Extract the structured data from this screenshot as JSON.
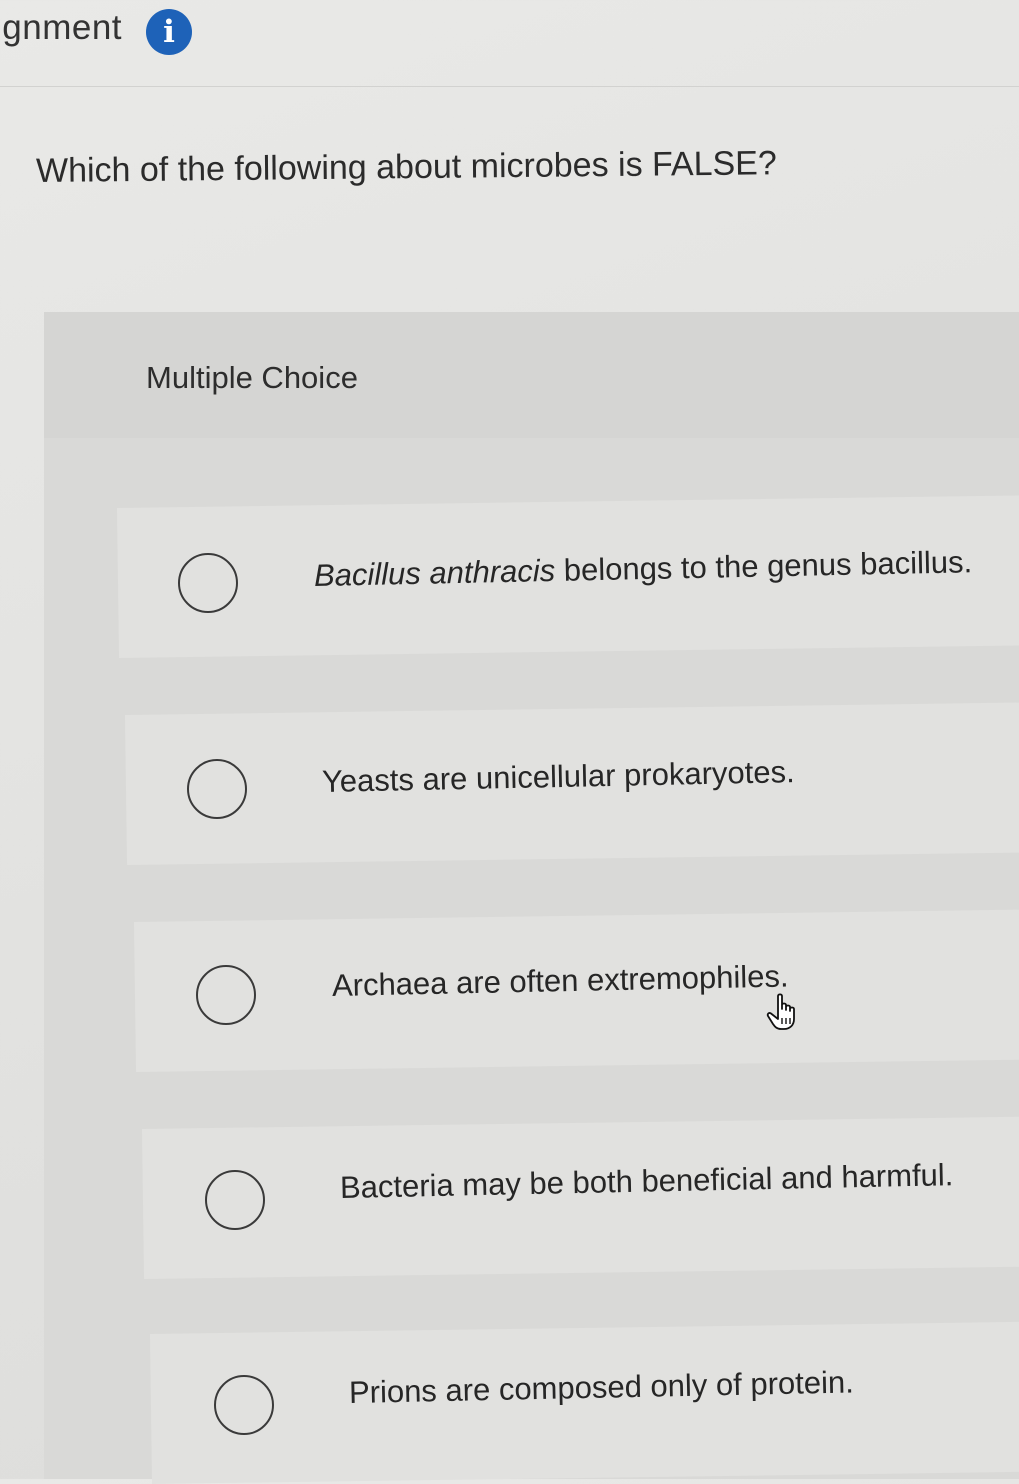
{
  "header": {
    "title": "ignment",
    "info_icon": "info-icon",
    "info_glyph": "i"
  },
  "question": {
    "text": "Which of the following about microbes is FALSE?"
  },
  "answer_section": {
    "type_label": "Multiple Choice",
    "options": [
      {
        "italic_part": "Bacillus anthracis",
        "text": " belongs to the genus bacillus.",
        "selected": false
      },
      {
        "italic_part": "",
        "text": "Yeasts are unicellular prokaryotes.",
        "selected": false
      },
      {
        "italic_part": "",
        "text": "Archaea are often extremophiles.",
        "selected": false
      },
      {
        "italic_part": "",
        "text": "Bacteria may be both beneficial and harmful.",
        "selected": false
      },
      {
        "italic_part": "",
        "text": "Prions are composed only of protein.",
        "selected": false
      }
    ]
  },
  "cursor": {
    "icon": "hand-pointer-icon"
  },
  "colors": {
    "info_icon_bg": "#1e62b8",
    "text": "#2b2b2b",
    "background": "#e6e6e4"
  }
}
